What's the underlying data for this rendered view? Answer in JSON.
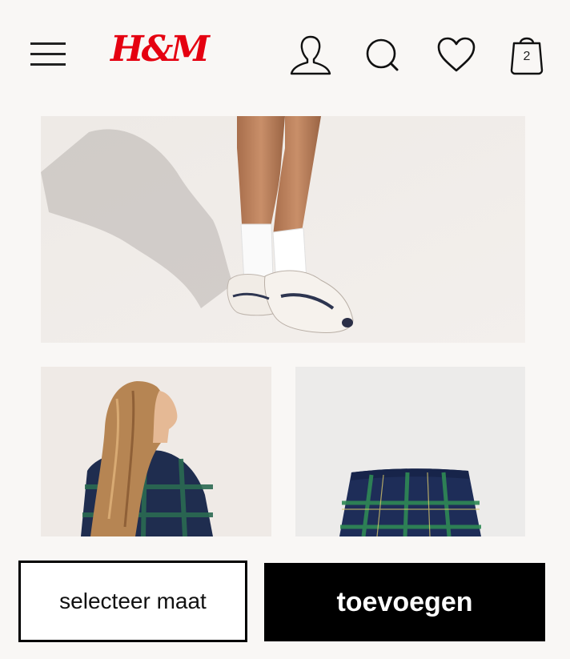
{
  "header": {
    "menu_icon": "hamburger-menu-icon",
    "logo_text": "H&M",
    "brand_color": "#e50010",
    "account_icon": "user-icon",
    "search_icon": "search-icon",
    "favorites_icon": "heart-icon",
    "cart_icon": "shopping-bag-icon",
    "cart_count": "2"
  },
  "gallery": {
    "images": [
      {
        "subject": "sneakers-with-white-socks"
      },
      {
        "subject": "model-in-plaid-shirt"
      },
      {
        "subject": "plaid-skirt"
      }
    ]
  },
  "actions": {
    "select_size_label": "selecteer maat",
    "add_to_cart_label": "toevoegen"
  }
}
